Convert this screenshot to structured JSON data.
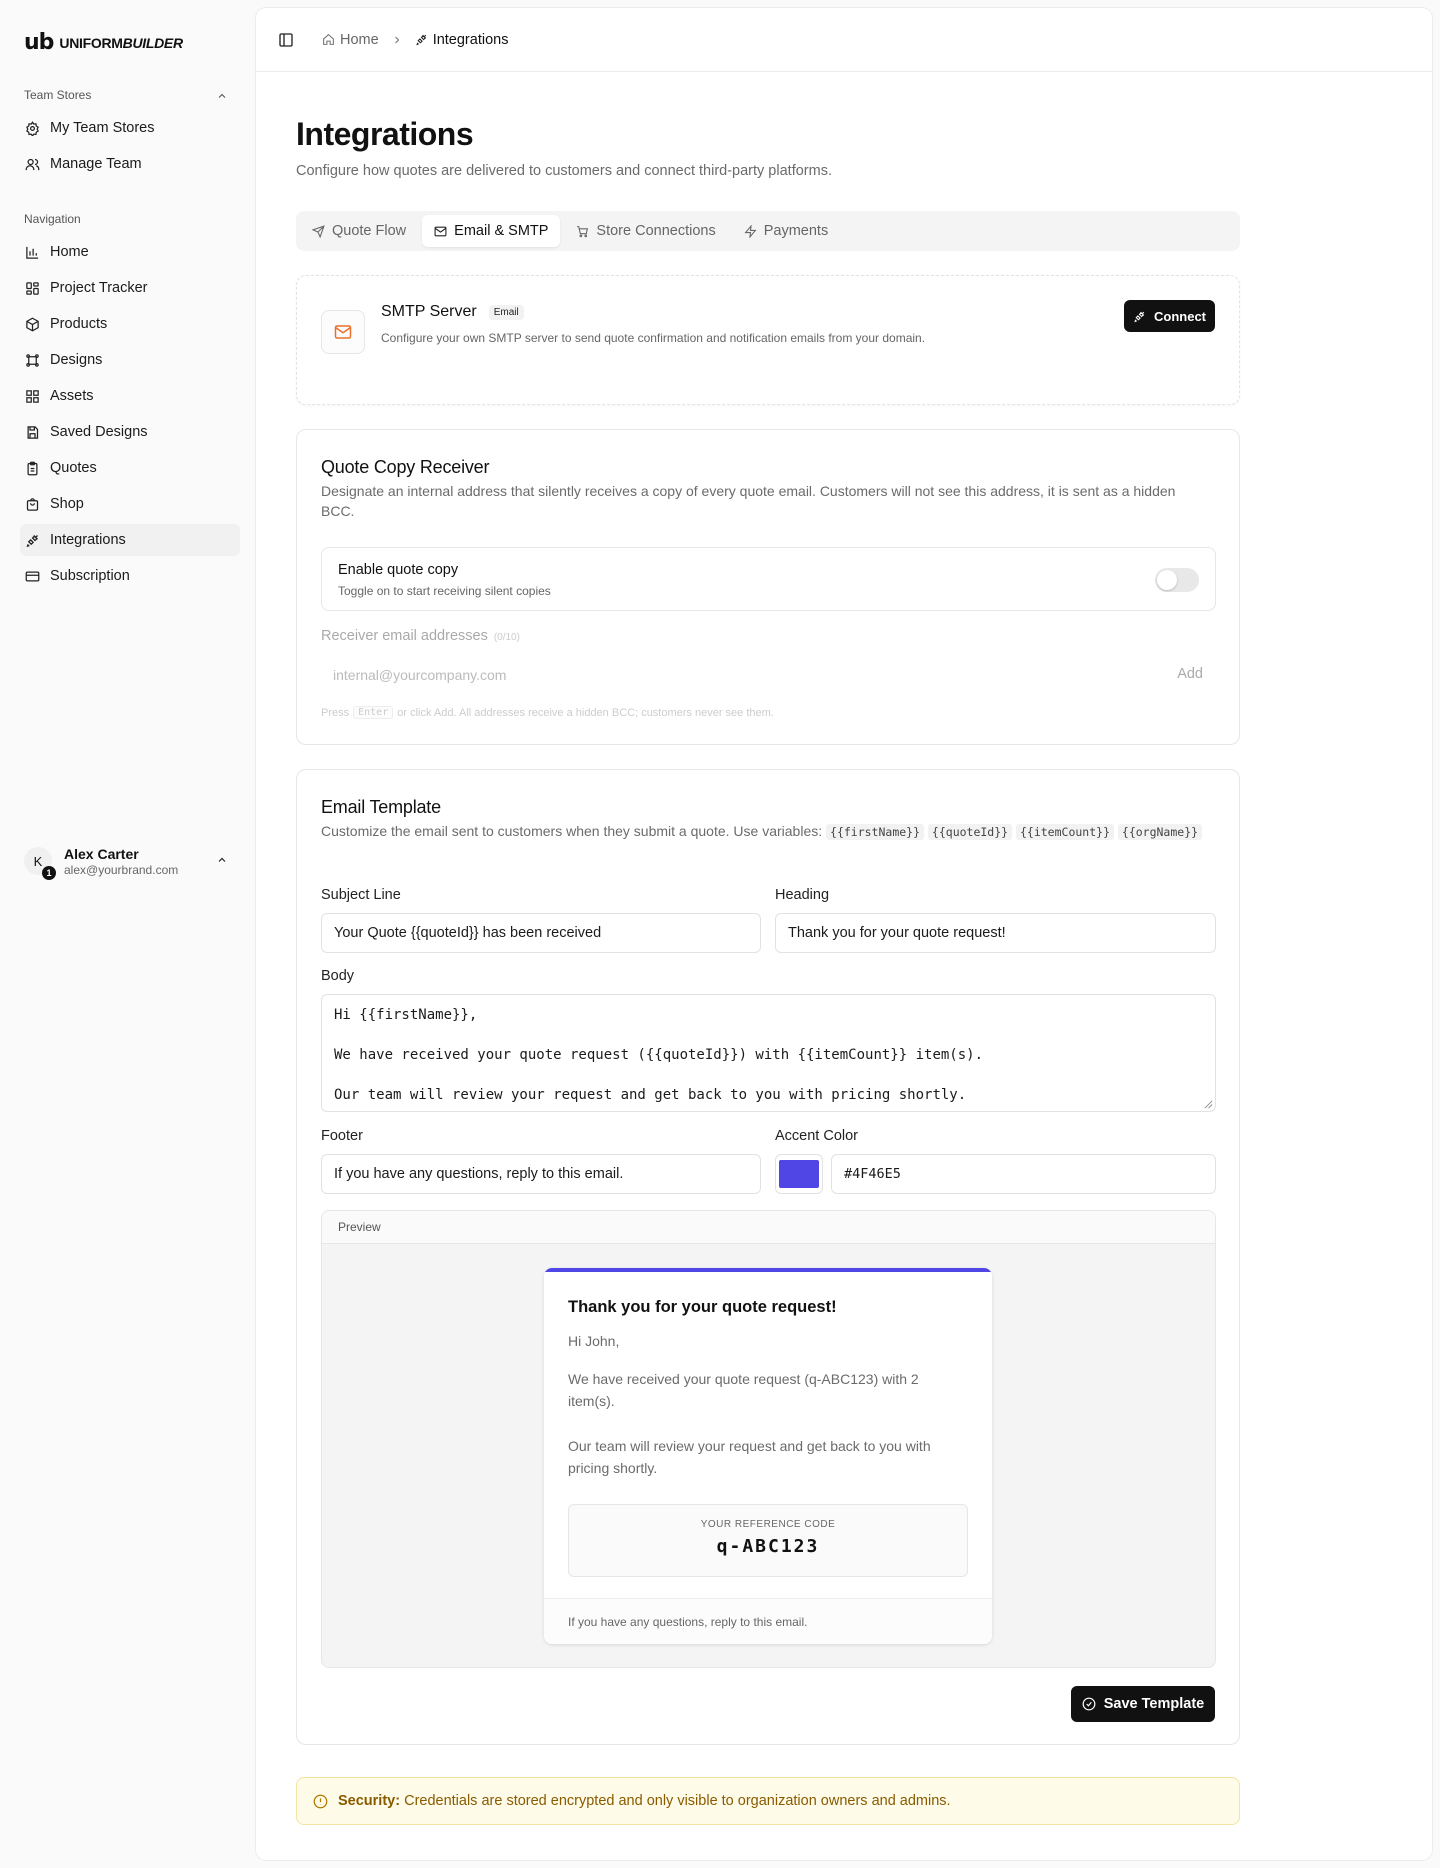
{
  "brand": {
    "mark": "ub",
    "name_regular": "UNIFORM",
    "name_italic": "BUILDER"
  },
  "sidebar": {
    "team_section_label": "Team Stores",
    "team_items": [
      {
        "label": "My Team Stores",
        "icon": "store-gear-icon"
      },
      {
        "label": "Manage Team",
        "icon": "users-icon"
      }
    ],
    "nav_section_label": "Navigation",
    "nav_items": [
      {
        "label": "Home",
        "icon": "bar-chart-icon"
      },
      {
        "label": "Project Tracker",
        "icon": "grid-icon"
      },
      {
        "label": "Products",
        "icon": "package-icon"
      },
      {
        "label": "Designs",
        "icon": "frame-icon"
      },
      {
        "label": "Assets",
        "icon": "assets-grid-icon"
      },
      {
        "label": "Saved Designs",
        "icon": "save-icon"
      },
      {
        "label": "Quotes",
        "icon": "clipboard-icon"
      },
      {
        "label": "Shop",
        "icon": "shop-icon"
      },
      {
        "label": "Integrations",
        "icon": "plug-icon",
        "active": true
      },
      {
        "label": "Subscription",
        "icon": "credit-card-icon"
      }
    ],
    "user": {
      "initial": "K",
      "badge": "1",
      "name": "Alex Carter",
      "email": "alex@yourbrand.com"
    }
  },
  "breadcrumb": {
    "home": "Home",
    "current": "Integrations"
  },
  "page": {
    "title": "Integrations",
    "subtitle": "Configure how quotes are delivered to customers and connect third-party platforms."
  },
  "tabs": [
    {
      "label": "Quote Flow",
      "icon": "send-icon"
    },
    {
      "label": "Email & SMTP",
      "icon": "mail-icon",
      "active": true
    },
    {
      "label": "Store Connections",
      "icon": "cart-icon"
    },
    {
      "label": "Payments",
      "icon": "zap-icon"
    }
  ],
  "smtp": {
    "title": "SMTP Server",
    "badge": "Email",
    "description": "Configure your own SMTP server to send quote confirmation and notification emails from your domain.",
    "connect_label": "Connect"
  },
  "quote_copy": {
    "title": "Quote Copy Receiver",
    "description": "Designate an internal address that silently receives a copy of every quote email. Customers will not see this address, it is sent as a hidden BCC.",
    "toggle_title": "Enable quote copy",
    "toggle_sub": "Toggle on to start receiving silent copies",
    "toggle_on": false,
    "receiver_label": "Receiver email addresses",
    "receiver_count": "(0/10)",
    "receiver_placeholder": "internal@yourcompany.com",
    "add_label": "Add",
    "hint_prefix": "Press",
    "hint_key": "Enter",
    "hint_suffix": "or click Add. All addresses receive a hidden BCC; customers never see them."
  },
  "email_template": {
    "title": "Email Template",
    "description": "Customize the email sent to customers when they submit a quote. Use variables:",
    "variables": [
      "{{firstName}}",
      "{{quoteId}}",
      "{{itemCount}}",
      "{{orgName}}"
    ],
    "subject_label": "Subject Line",
    "subject_value": "Your Quote {{quoteId}} has been received",
    "heading_label": "Heading",
    "heading_value": "Thank you for your quote request!",
    "body_label": "Body",
    "body_lines": [
      "Hi {{firstName}},",
      "We have received your quote request ({{quoteId}}) with {{itemCount}} item(s).",
      "Our team will review your request and get back to you with pricing shortly."
    ],
    "footer_label": "Footer",
    "footer_value": "If you have any questions, reply to this email.",
    "accent_label": "Accent Color",
    "accent_value": "#4F46E5",
    "accent_color": "#4F46E5",
    "preview_label": "Preview",
    "preview": {
      "heading": "Thank you for your quote request!",
      "greeting": "Hi John,",
      "para1": "We have received your quote request (q-ABC123) with 2 item(s).",
      "para2": "Our team will review your request and get back to you with pricing shortly.",
      "ref_label": "YOUR REFERENCE CODE",
      "ref_code": "q-ABC123",
      "footer": "If you have any questions, reply to this email."
    },
    "save_label": "Save Template"
  },
  "security": {
    "label": "Security:",
    "text": "Credentials are stored encrypted and only visible to organization owners and admins."
  }
}
